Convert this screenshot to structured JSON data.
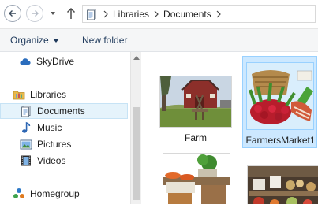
{
  "address_bar": {
    "breadcrumb": [
      "Libraries",
      "Documents"
    ]
  },
  "command_bar": {
    "organize_label": "Organize",
    "new_folder_label": "New folder"
  },
  "navigation_pane": {
    "items": [
      {
        "label": "SkyDrive",
        "icon": "cloud-icon"
      },
      {
        "label": "Libraries",
        "icon": "libraries-folder-icon"
      },
      {
        "label": "Documents",
        "icon": "documents-icon",
        "selected": true
      },
      {
        "label": "Music",
        "icon": "music-note-icon"
      },
      {
        "label": "Pictures",
        "icon": "pictures-icon"
      },
      {
        "label": "Videos",
        "icon": "video-film-icon"
      },
      {
        "label": "Homegroup",
        "icon": "homegroup-icon"
      }
    ]
  },
  "content": {
    "files": [
      {
        "name": "Farm",
        "kind": "image",
        "selected": false
      },
      {
        "name": "FarmersMarket1",
        "kind": "image",
        "selected": true
      },
      {
        "name": "",
        "kind": "image",
        "selected": false
      },
      {
        "name": "",
        "kind": "image",
        "selected": false
      }
    ]
  },
  "colors": {
    "selection_fill": "#cce8ff",
    "selection_border": "#99d1ff",
    "nav_selection_fill": "#e5f3fb",
    "command_text": "#1e395b",
    "command_bar_bg": "#f5f6f7"
  }
}
